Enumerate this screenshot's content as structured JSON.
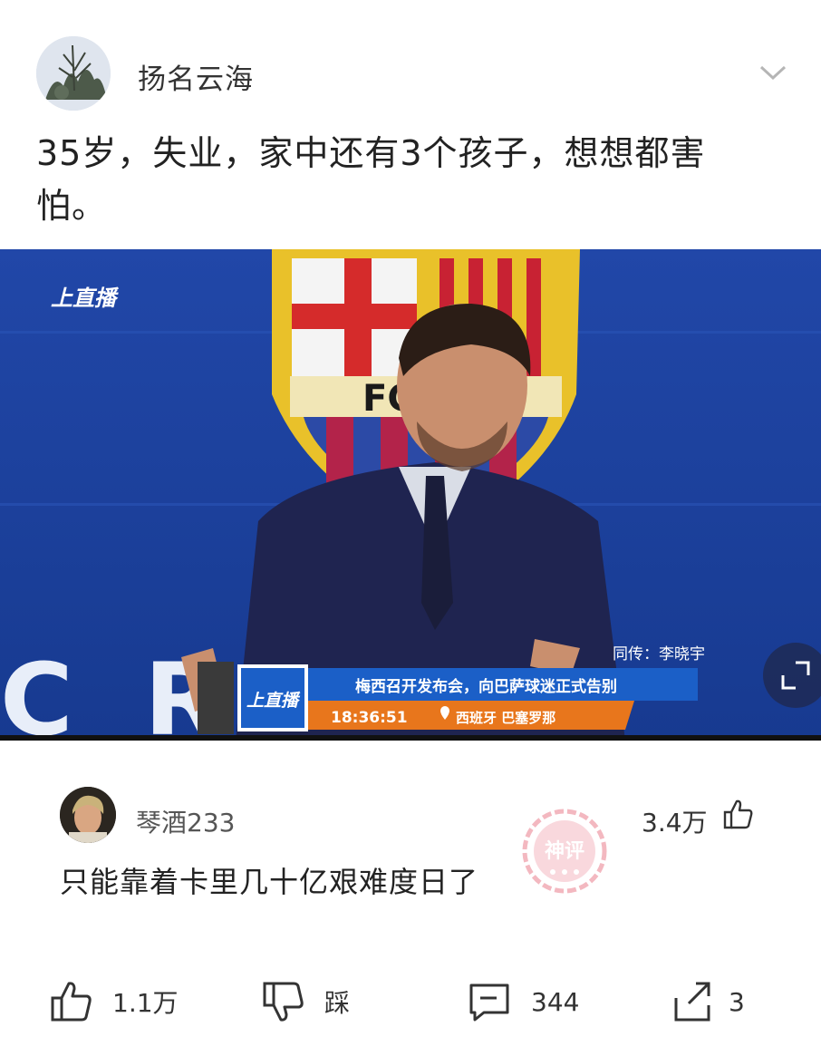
{
  "post": {
    "author": "扬名云海",
    "text": "35岁，失业，家中还有3个孩子，想想都害怕。"
  },
  "video": {
    "watermark": "上直播",
    "correspondent": "同传：李晓宇",
    "lower_third_logo": "上直播",
    "headline": "梅西召开发布会，向巴萨球迷正式告别",
    "time": "18:36:51",
    "location": "西班牙 巴塞罗那",
    "crest_text": "FC",
    "backdrop_text": "C R   ON"
  },
  "top_comment": {
    "username": "琴酒233",
    "likes": "3.4万",
    "text": "只能靠着卡里几十亿艰难度日了",
    "badge": "神评"
  },
  "actions": {
    "like_count": "1.1万",
    "dislike_label": "踩",
    "comment_count": "344",
    "share_count": "3"
  },
  "colors": {
    "video_blue": "#1e3f9c",
    "lower_third_blue": "#1b5fc7",
    "lower_third_orange": "#e8761c",
    "stamp_pink": "#f3b8c0"
  }
}
